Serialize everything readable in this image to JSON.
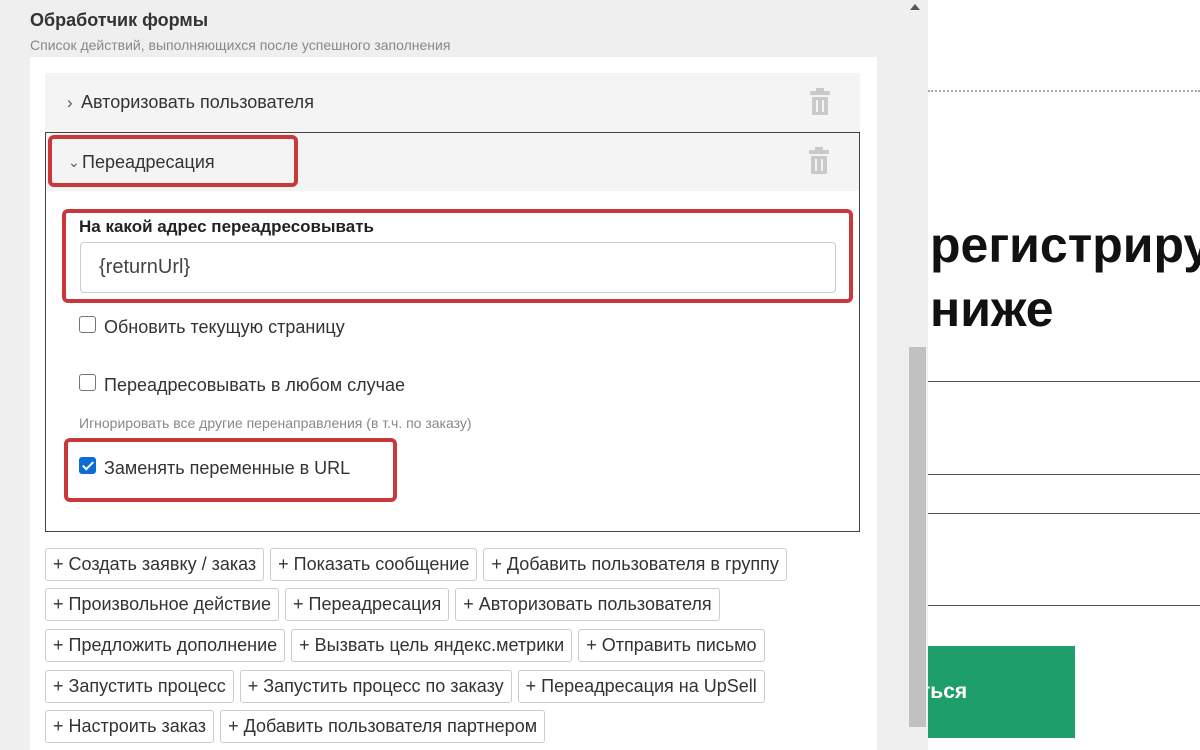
{
  "modal": {
    "title": "Обработчик формы",
    "subtitle": "Список действий, выполняющихся после успешного заполнения"
  },
  "actions": [
    {
      "label": "Авторизовать пользователя",
      "expanded": false
    },
    {
      "label": "Переадресация",
      "expanded": true
    }
  ],
  "redirect": {
    "field_label": "На какой адрес переадресовывать",
    "field_value": "{returnUrl}",
    "checkboxes": [
      {
        "label": "Обновить текущую страницу",
        "checked": false
      },
      {
        "label": "Переадресовывать в любом случае",
        "checked": false
      },
      {
        "label": "Заменять переменные в URL",
        "checked": true
      }
    ],
    "hint": "Игнорировать все другие перенаправления (в т.ч. по заказу)"
  },
  "add_buttons": [
    [
      "+ Создать заявку / заказ",
      "+ Показать сообщение",
      "+ Добавить пользователя в группу"
    ],
    [
      "+ Произвольное действие",
      "+ Переадресация",
      "+ Авторизовать пользователя"
    ],
    [
      "+ Предложить дополнение",
      "+ Вызвать цель яндекс.метрики",
      "+ Отправить письмо"
    ],
    [
      "+ Запустить процесс",
      "+ Запустить процесс по заказу",
      "+ Переадресация на UpSell"
    ],
    [
      "+ Настроить заказ",
      "+ Добавить пользователя партнером"
    ]
  ],
  "background_page": {
    "heading_line1": "регистриру",
    "heading_line2": "ниже",
    "button_text": "ться"
  },
  "colors": {
    "highlight": "#c9383a",
    "checkbox_checked": "#0b6ed6",
    "bg_button": "#1e9e68"
  },
  "icons": {
    "chevron_collapsed": "›",
    "chevron_expanded": "⌄",
    "delete": "trash-icon"
  }
}
